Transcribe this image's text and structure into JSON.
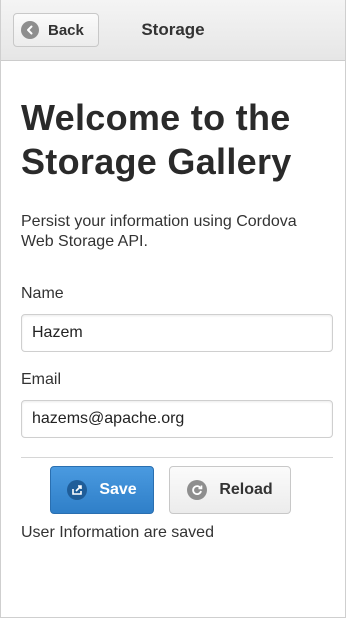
{
  "header": {
    "back_label": "Back",
    "title": "Storage"
  },
  "main": {
    "heading": "Welcome to the Storage Gallery",
    "description": "Persist your information using Cordova Web Storage API.",
    "name_field": {
      "label": "Name",
      "value": "Hazem"
    },
    "email_field": {
      "label": "Email",
      "value": "hazems@apache.org"
    },
    "save_button": {
      "label": "Save",
      "icon": "share-icon"
    },
    "reload_button": {
      "label": "Reload",
      "icon": "refresh-icon"
    },
    "status_text": "User Information are saved"
  },
  "colors": {
    "primary_button": "#3388d4",
    "header_bg": "#ececec"
  }
}
